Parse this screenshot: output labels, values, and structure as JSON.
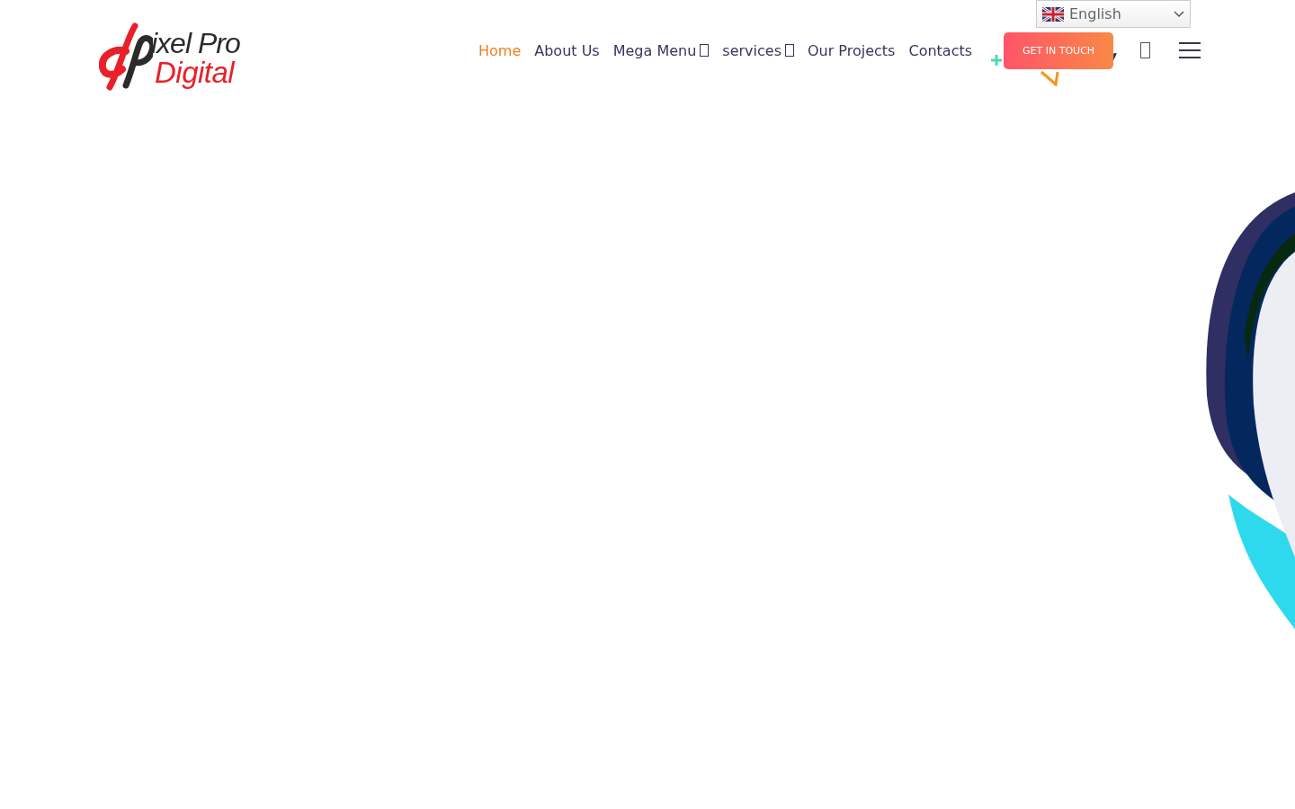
{
  "logo": {
    "line1": "ixel Pro",
    "line2": "Digital"
  },
  "nav": [
    {
      "label": "Home",
      "selected": true,
      "dropdown": false
    },
    {
      "label": "About Us",
      "selected": false,
      "dropdown": false
    },
    {
      "label": "Mega Menu",
      "selected": false,
      "dropdown": true
    },
    {
      "label": "services",
      "selected": false,
      "dropdown": true
    },
    {
      "label": "Our Projects",
      "selected": false,
      "dropdown": false
    },
    {
      "label": "Contacts",
      "selected": false,
      "dropdown": false
    }
  ],
  "language": {
    "label": "English"
  },
  "cta": {
    "label": "GET IN TOUCH"
  }
}
